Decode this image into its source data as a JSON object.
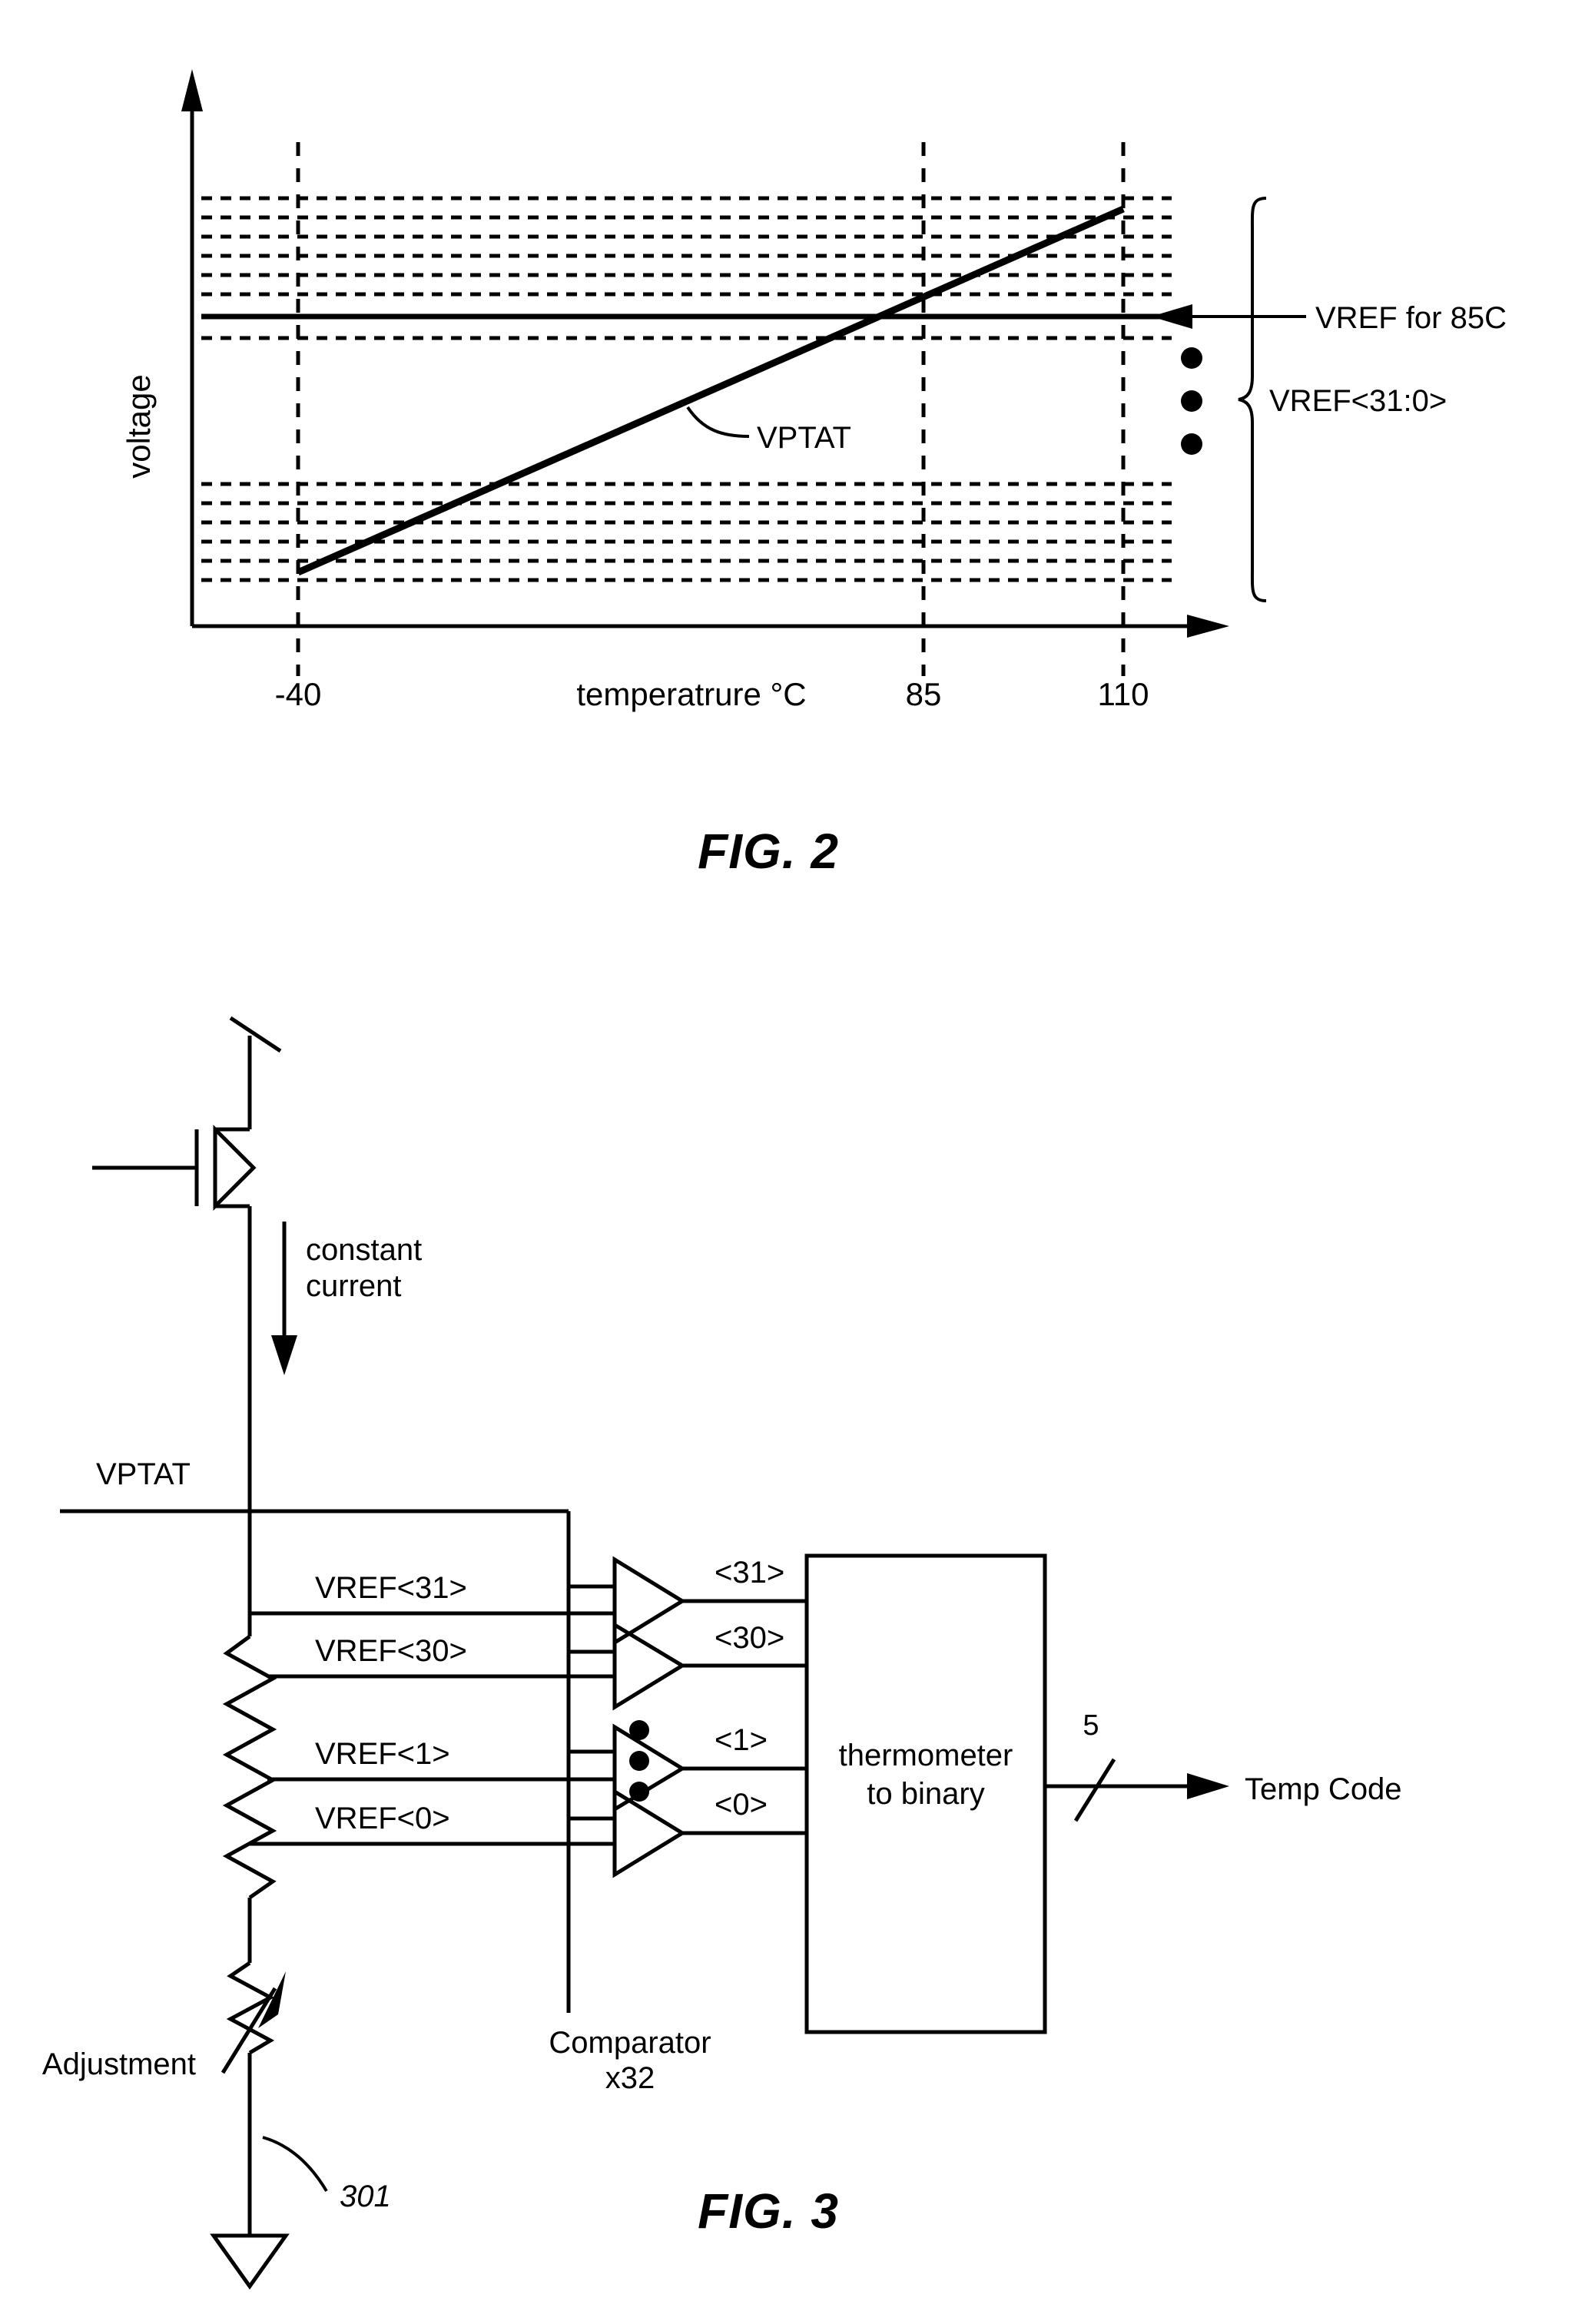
{
  "page": {
    "background": "#ffffff",
    "ink": "#000000"
  },
  "figures": [
    {
      "id": "fig2",
      "caption": "FIG. 2",
      "type": "chart",
      "axis": {
        "ylabel": "voltage",
        "xlabel": "temperatrure °C",
        "xticks": [
          "-40",
          "85",
          "110"
        ]
      },
      "annotations": {
        "vptat": "VPTAT",
        "vref_85c": "VREF for 85C",
        "vref_range": "VREF<31:0>"
      }
    },
    {
      "id": "fig3",
      "caption": "FIG. 3",
      "type": "circuit",
      "labels": {
        "constant_current": "constant\ncurrent",
        "constant_current_line1": "constant",
        "constant_current_line2": "current",
        "vptat": "VPTAT",
        "adjustment": "Adjustment",
        "reference_numeral": "301",
        "comparator_line1": "Comparator",
        "comparator_line2": "x32",
        "block_line1": "thermometer",
        "block_line2": "to binary",
        "bus_width": "5",
        "output": "Temp Code"
      },
      "vref_taps": [
        "VREF<31>",
        "VREF<30>",
        "VREF<1>",
        "VREF<0>"
      ],
      "comparator_outputs": [
        "<31>",
        "<30>",
        "<1>",
        "<0>"
      ]
    }
  ],
  "chart_data": {
    "type": "line",
    "title": "FIG. 2",
    "xlabel": "temperatrure °C",
    "ylabel": "voltage",
    "xticks": [
      -40,
      85,
      110
    ],
    "xtick_labels": [
      "-40",
      "85",
      "110"
    ],
    "xlim": [
      -75,
      130
    ],
    "ylim": [
      0,
      1
    ],
    "grid": false,
    "series": [
      {
        "name": "VPTAT",
        "type": "line",
        "x": [
          -40,
          110
        ],
        "y": [
          0.22,
          0.86
        ]
      }
    ],
    "reference_levels": {
      "name": "VREF<31:0>",
      "count": 32,
      "shown_upper_group_y": [
        0.835,
        0.805,
        0.775,
        0.745,
        0.715,
        0.685
      ],
      "highlighted": {
        "label": "VREF for 85C",
        "y": 0.655,
        "style": "solid"
      },
      "shown_upper_group_below_y": [
        0.625
      ],
      "shown_lower_group_y": [
        0.335,
        0.305,
        0.275,
        0.245,
        0.215,
        0.185
      ],
      "ellipsis_dots": 3
    },
    "annotations": [
      {
        "text": "VPTAT",
        "target": "line"
      },
      {
        "text": "VREF for 85C",
        "target": "solid reference level"
      },
      {
        "text": "VREF<31:0>",
        "target": "brace over all reference levels"
      }
    ]
  }
}
